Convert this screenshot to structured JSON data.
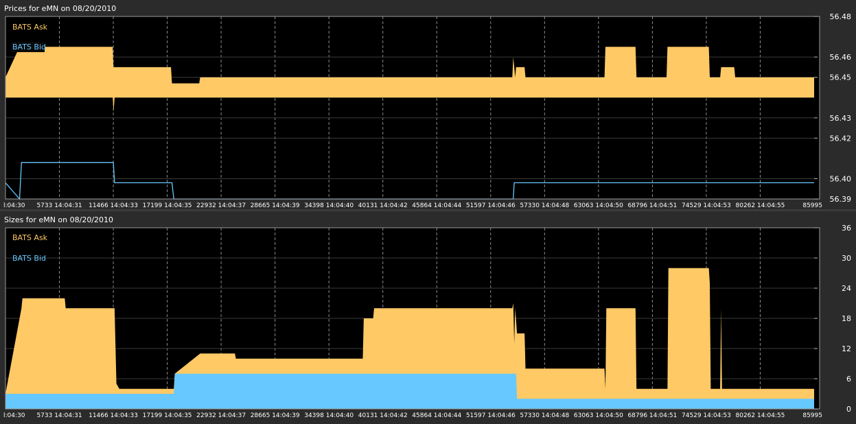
{
  "panels": {
    "prices": {
      "title": "Prices for  eMN  on  08/20/2010",
      "legend": [
        {
          "label": "BATS Ask",
          "color": "#ffc966"
        },
        {
          "label": "BATS Bid",
          "color": "#66c8ff"
        }
      ]
    },
    "sizes": {
      "title": "Sizes for  eMN  on  08/20/2010",
      "legend": [
        {
          "label": "BATS Ask",
          "color": "#ffc966"
        },
        {
          "label": "BATS Bid",
          "color": "#66c8ff"
        }
      ]
    }
  },
  "colors": {
    "ask": "#ffc966",
    "bid": "#66c8ff",
    "plot_bg": "#000000",
    "frame_bg": "#2b2b2b",
    "text": "#ffffff",
    "grid": "#8c8c8c"
  },
  "chart_data": [
    {
      "type": "line",
      "panel": "prices",
      "x_tick_labels": [
        "l:04:30",
        "5733 14:04:31",
        "11466 14:04:33",
        "17199 14:04:35",
        "22932 14:04:37",
        "28665 14:04:39",
        "34398 14:04:40",
        "40131 14:04:42",
        "45864 14:04:44",
        "51597 14:04:46",
        "57330 14:04:48",
        "63063 14:04:50",
        "68796 14:04:51",
        "74529 14:04:53",
        "80262 14:04:55",
        "85995"
      ],
      "x_ticks": [
        0,
        5733,
        11466,
        17199,
        22932,
        28665,
        34398,
        40131,
        45864,
        51597,
        57330,
        63063,
        68796,
        74529,
        80262,
        85995
      ],
      "xlim": [
        0,
        85995
      ],
      "y_tick_labels": [
        "56.39",
        "56.40",
        "56.42",
        "56.43",
        "56.45",
        "56.46",
        "56.48"
      ],
      "y_ticks": [
        56.39,
        56.4,
        56.42,
        56.43,
        56.45,
        56.46,
        56.48
      ],
      "ylim": [
        56.39,
        56.48
      ],
      "grid": true,
      "legend_position": "top-left",
      "series": [
        {
          "name": "BATS Ask",
          "style": "band",
          "top": [
            [
              0,
              56.45
            ],
            [
              1500,
              56.465
            ],
            [
              11400,
              56.465
            ],
            [
              11466,
              56.455
            ],
            [
              17600,
              56.455
            ],
            [
              17700,
              56.447
            ],
            [
              20600,
              56.447
            ],
            [
              20700,
              56.45
            ],
            [
              53900,
              56.45
            ],
            [
              54000,
              56.46
            ],
            [
              54200,
              56.45
            ],
            [
              54300,
              56.455
            ],
            [
              55200,
              56.455
            ],
            [
              55300,
              56.45
            ],
            [
              63700,
              56.45
            ],
            [
              63800,
              56.465
            ],
            [
              67000,
              56.465
            ],
            [
              67100,
              56.45
            ],
            [
              70300,
              56.45
            ],
            [
              70400,
              56.465
            ],
            [
              74800,
              56.465
            ],
            [
              74900,
              56.45
            ],
            [
              76000,
              56.45
            ],
            [
              76100,
              56.455
            ],
            [
              77500,
              56.455
            ],
            [
              77600,
              56.45
            ],
            [
              85995,
              56.45
            ]
          ],
          "bottom": [
            [
              0,
              56.44
            ],
            [
              11400,
              56.44
            ],
            [
              11500,
              56.433
            ],
            [
              11600,
              56.44
            ],
            [
              85995,
              56.44
            ]
          ]
        },
        {
          "name": "BATS Bid",
          "style": "step",
          "values": [
            [
              0,
              56.398
            ],
            [
              1500,
              56.39
            ],
            [
              1700,
              56.408
            ],
            [
              11466,
              56.408
            ],
            [
              11600,
              56.398
            ],
            [
              17700,
              56.398
            ],
            [
              17900,
              56.39
            ],
            [
              54000,
              56.39
            ],
            [
              54100,
              56.398
            ],
            [
              85995,
              56.398
            ]
          ]
        }
      ]
    },
    {
      "type": "area",
      "panel": "sizes",
      "x_tick_labels": [
        "l:04:30",
        "5733 14:04:31",
        "11466 14:04:33",
        "17199 14:04:35",
        "22932 14:04:37",
        "28665 14:04:39",
        "34398 14:04:40",
        "40131 14:04:42",
        "45864 14:04:44",
        "51597 14:04:46",
        "57330 14:04:48",
        "63063 14:04:50",
        "68796 14:04:51",
        "74529 14:04:53",
        "80262 14:04:55",
        "85995"
      ],
      "x_ticks": [
        0,
        5733,
        11466,
        17199,
        22932,
        28665,
        34398,
        40131,
        45864,
        51597,
        57330,
        63063,
        68796,
        74529,
        80262,
        85995
      ],
      "xlim": [
        0,
        85995
      ],
      "y_tick_labels": [
        "0",
        "6",
        "12",
        "18",
        "24",
        "30",
        "36"
      ],
      "y_ticks": [
        0,
        6,
        12,
        18,
        24,
        30,
        36
      ],
      "ylim": [
        0,
        36
      ],
      "grid": true,
      "legend_position": "top-left",
      "series": [
        {
          "name": "BATS Ask",
          "values": [
            [
              0,
              3
            ],
            [
              1700,
              20
            ],
            [
              1800,
              22
            ],
            [
              6300,
              22
            ],
            [
              6400,
              20
            ],
            [
              11600,
              20
            ],
            [
              11800,
              5
            ],
            [
              12100,
              4
            ],
            [
              17900,
              4
            ],
            [
              18000,
              7
            ],
            [
              20700,
              11
            ],
            [
              24400,
              11
            ],
            [
              24500,
              10
            ],
            [
              38000,
              10
            ],
            [
              38100,
              18
            ],
            [
              39100,
              18
            ],
            [
              39200,
              20
            ],
            [
              53900,
              20
            ],
            [
              54000,
              21
            ],
            [
              54100,
              13
            ],
            [
              54200,
              20
            ],
            [
              54400,
              15
            ],
            [
              55200,
              15
            ],
            [
              55300,
              8
            ],
            [
              63700,
              8
            ],
            [
              63800,
              4
            ],
            [
              63900,
              20
            ],
            [
              67000,
              20
            ],
            [
              67100,
              4
            ],
            [
              70400,
              4
            ],
            [
              70500,
              28
            ],
            [
              74800,
              28
            ],
            [
              74900,
              25
            ],
            [
              75000,
              4
            ],
            [
              76000,
              4
            ],
            [
              76100,
              20
            ],
            [
              76200,
              4
            ],
            [
              85995,
              4
            ]
          ]
        },
        {
          "name": "BATS Bid",
          "values": [
            [
              0,
              3
            ],
            [
              17900,
              3
            ],
            [
              18000,
              7
            ],
            [
              54300,
              7
            ],
            [
              54400,
              2
            ],
            [
              85995,
              2
            ]
          ]
        }
      ]
    }
  ]
}
